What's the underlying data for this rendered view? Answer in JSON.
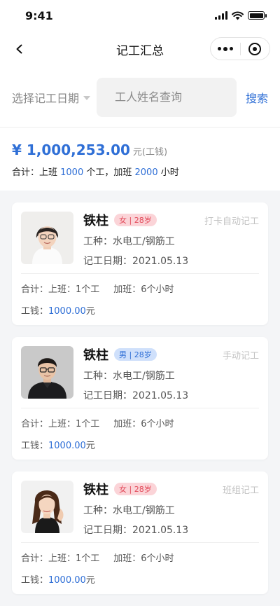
{
  "status_bar": {
    "time": "9:41"
  },
  "nav": {
    "title": "记工汇总"
  },
  "filter": {
    "date_label": "选择记工日期",
    "search_placeholder": "工人姓名查询",
    "search_button": "搜索"
  },
  "summary": {
    "amount": "¥ 1,000,253.00",
    "amount_unit": "元(工钱)",
    "totals_prefix": "合计：上班 ",
    "work_units": "1000",
    "work_units_suffix": " 个工，加班 ",
    "overtime_hours": "2000",
    "overtime_suffix": " 小时"
  },
  "records": [
    {
      "name": "铁柱",
      "gender_age": "女 | 28岁",
      "gender": "female",
      "method": "打卡自动记工",
      "trade": "工种：水电工/钢筋工",
      "date": "记工日期：2021.05.13",
      "work": "合计：上班：1个工",
      "overtime": "加班：6个小时",
      "pay_label": "工钱：",
      "pay_value": "1000.00",
      "pay_unit": "元"
    },
    {
      "name": "铁柱",
      "gender_age": "男 | 28岁",
      "gender": "male",
      "method": "手动记工",
      "trade": "工种：水电工/钢筋工",
      "date": "记工日期：2021.05.13",
      "work": "合计：上班：1个工",
      "overtime": "加班：6个小时",
      "pay_label": "工钱：",
      "pay_value": "1000.00",
      "pay_unit": "元"
    },
    {
      "name": "铁柱",
      "gender_age": "女 | 28岁",
      "gender": "female",
      "method": "班组记工",
      "trade": "工种：水电工/钢筋工",
      "date": "记工日期：2021.05.13",
      "work": "合计：上班：1个工",
      "overtime": "加班：6个小时",
      "pay_label": "工钱：",
      "pay_value": "1000.00",
      "pay_unit": "元"
    }
  ],
  "colors": {
    "accent": "#2f6fd6",
    "female_badge_bg": "#fbd4d8",
    "female_badge_text": "#e24a5a",
    "male_badge_bg": "#cfe0fb",
    "male_badge_text": "#2f6fd6"
  }
}
